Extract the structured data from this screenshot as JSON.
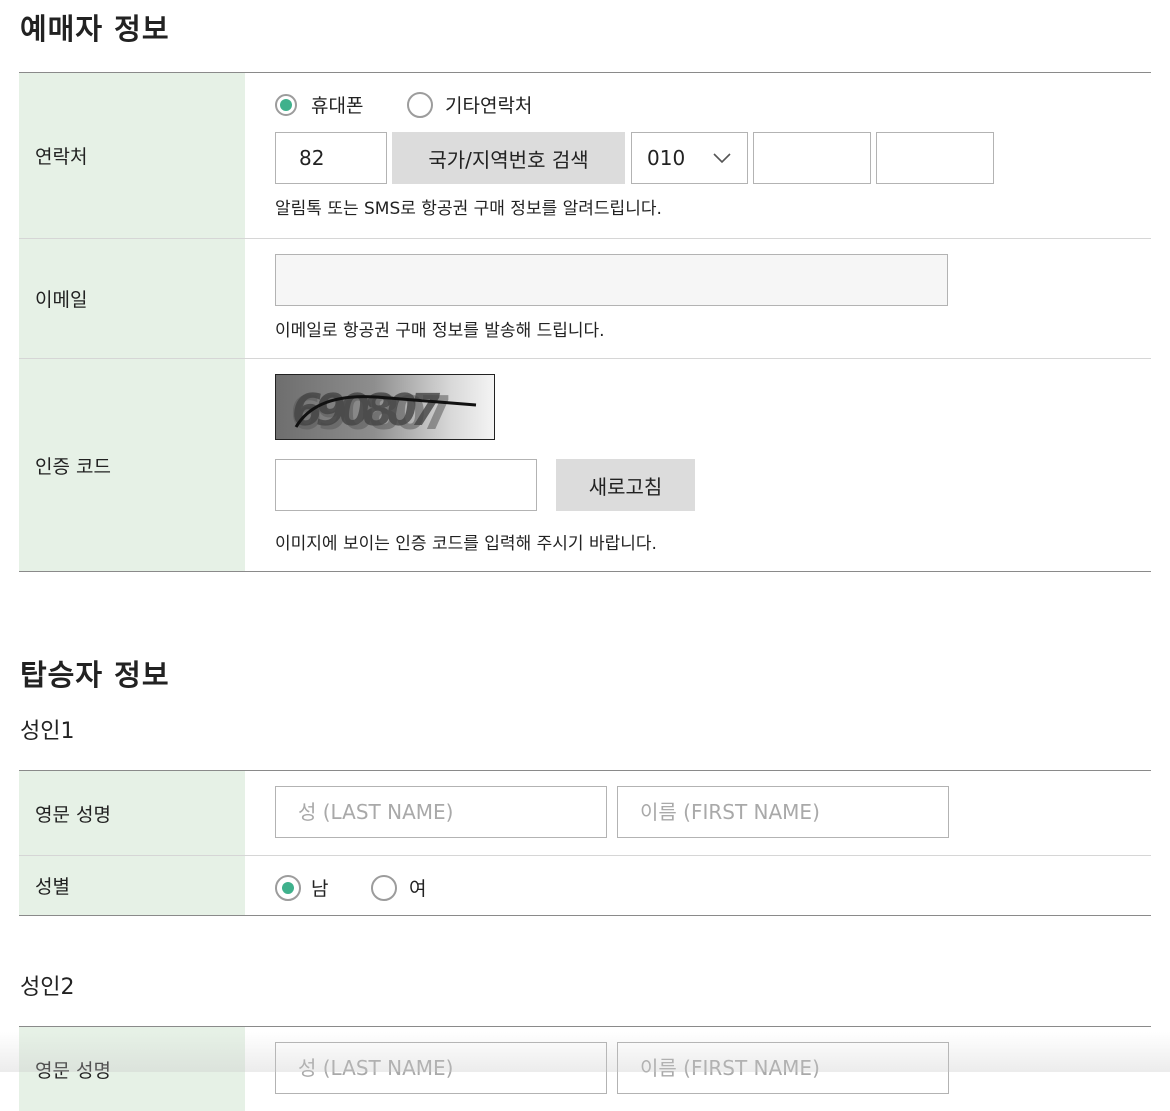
{
  "buyer_section": {
    "title": "예매자 정보",
    "contact": {
      "label": "연락처",
      "radio_mobile": "휴대폰",
      "radio_other": "기타연락처",
      "country_code": "82",
      "country_search_button": "국가/지역번호 검색",
      "prefix_select": "010",
      "help": "알림톡 또는 SMS로 항공권 구매 정보를 알려드립니다."
    },
    "email": {
      "label": "이메일",
      "help": "이메일로 항공권 구매 정보를 발송해 드립니다."
    },
    "captcha": {
      "label": "인증 코드",
      "image_text": "690807",
      "refresh_button": "새로고침",
      "help": "이미지에 보이는 인증 코드를 입력해 주시기 바랍니다."
    }
  },
  "passenger_section": {
    "title": "탑승자 정보",
    "adult1": {
      "title": "성인1",
      "name_label": "영문 성명",
      "last_name_placeholder": "성 (LAST NAME)",
      "first_name_placeholder": "이름 (FIRST NAME)",
      "gender_label": "성별",
      "gender_male": "남",
      "gender_female": "여"
    },
    "adult2": {
      "title": "성인2",
      "name_label": "영문 성명",
      "last_name_placeholder": "성 (LAST NAME)",
      "first_name_placeholder": "이름 (FIRST NAME)"
    }
  },
  "colors": {
    "label_bg": "#e6f1e6",
    "radio_accent": "#3fb18c",
    "button_gray": "#dcdcdc"
  }
}
